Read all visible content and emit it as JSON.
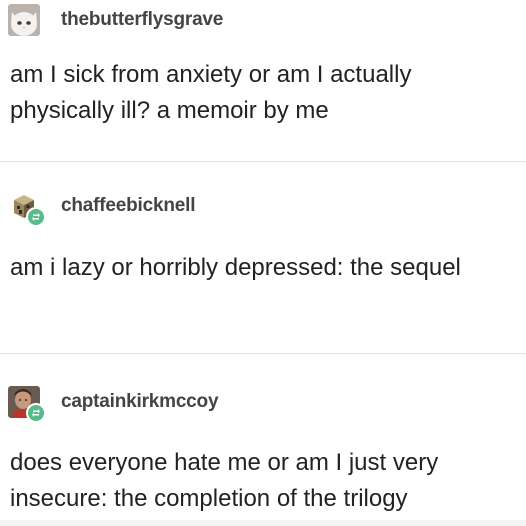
{
  "posts": [
    {
      "username": "thebutterflysgrave",
      "avatar": "white-cat-avatar",
      "text": "am I sick from anxiety or am I actually physically ill? a memoir by me",
      "reblog_badge": false
    },
    {
      "username": "chaffeebicknell",
      "avatar": "minecraft-creeper-avatar",
      "text": "am i lazy or horribly depressed: the sequel",
      "reblog_badge": true
    },
    {
      "username": "captainkirkmccoy",
      "avatar": "star-trek-portrait-avatar",
      "text": "does everyone hate me or am I just very insecure: the completion of the trilogy",
      "reblog_badge": true
    }
  ],
  "colors": {
    "username": "#444444",
    "body_text": "#222222",
    "divider": "#e3e3e3",
    "reblog_badge": "#56bc8a"
  },
  "icons": {
    "reblog": "reblog-icon"
  }
}
